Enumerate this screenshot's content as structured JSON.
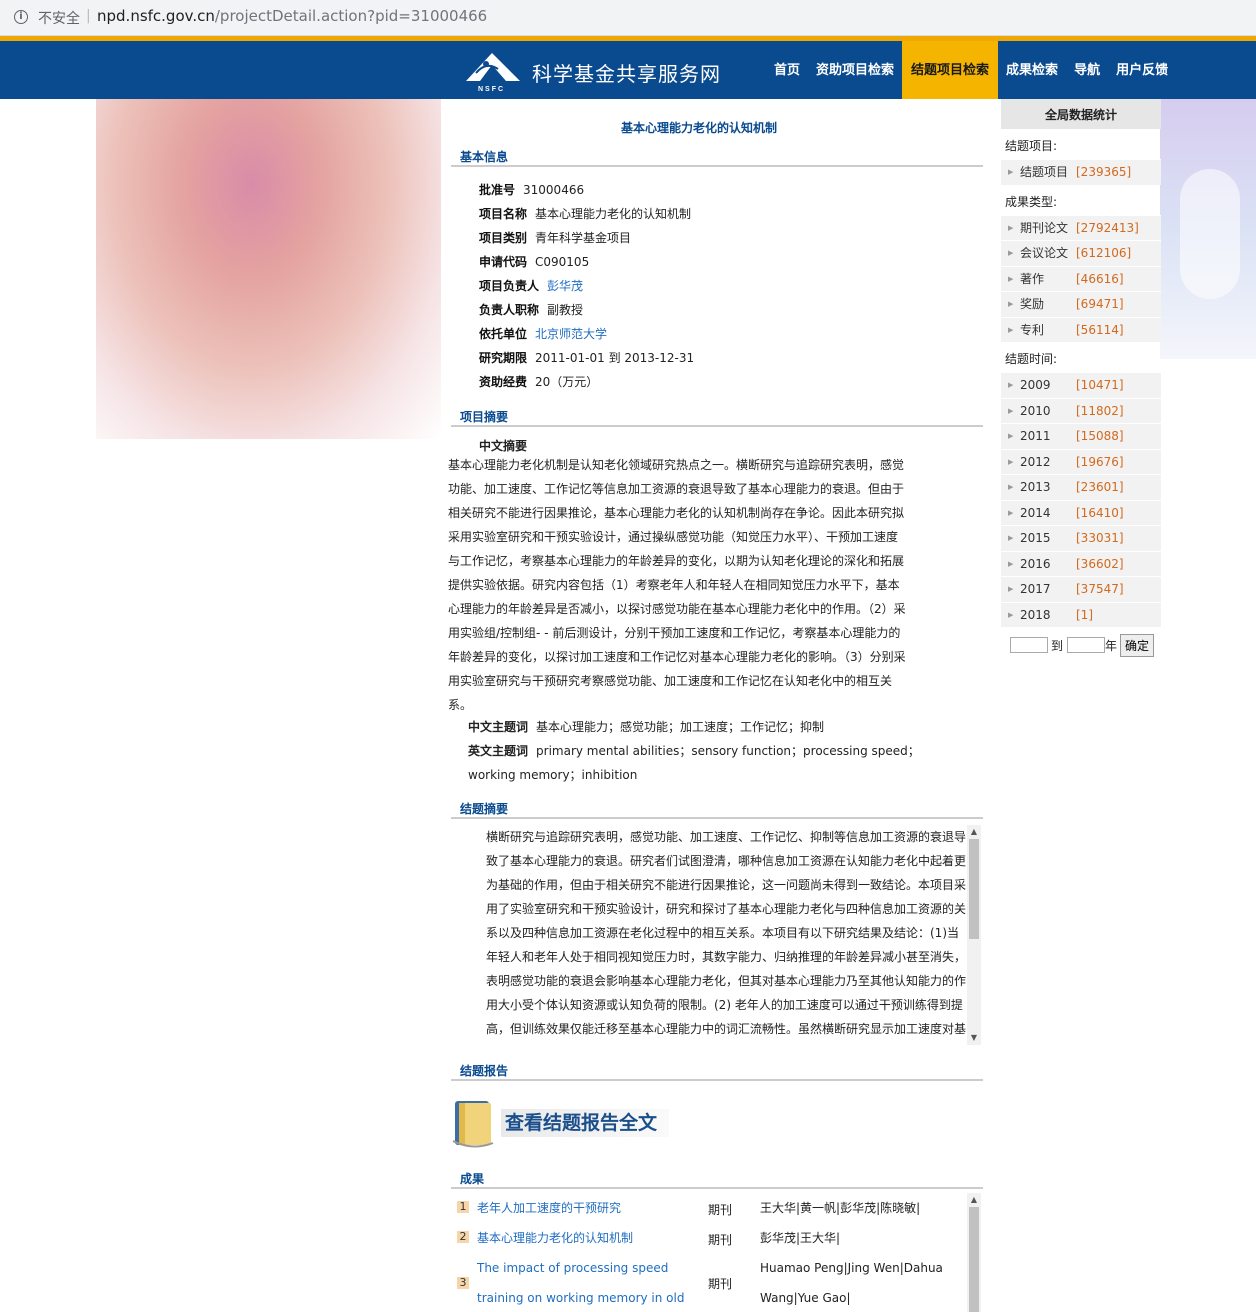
{
  "browser": {
    "security": "不安全",
    "host": "npd.nsfc.gov.cn",
    "path": "/projectDetail.action?pid=31000466"
  },
  "header": {
    "logo_text": "NSFC",
    "site_title": "科学基金共享服务网",
    "nav": [
      {
        "label": "首页"
      },
      {
        "label": "资助项目检索"
      },
      {
        "label": "结题项目检索",
        "active": true
      },
      {
        "label": "成果检索"
      },
      {
        "label": "导航"
      },
      {
        "label": "用户反馈"
      }
    ]
  },
  "project": {
    "title": "基本心理能力老化的认知机制",
    "basic_hd": "基本信息",
    "info": [
      {
        "label": "批准号",
        "value": "31000466"
      },
      {
        "label": "项目名称",
        "value": "基本心理能力老化的认知机制"
      },
      {
        "label": "项目类别",
        "value": "青年科学基金项目"
      },
      {
        "label": "申请代码",
        "value": "C090105"
      },
      {
        "label": "项目负责人",
        "value": "彭华茂"
      },
      {
        "label": "负责人职称",
        "value": "副教授"
      },
      {
        "label": "依托单位",
        "value": "北京师范大学"
      },
      {
        "label": "研究期限",
        "value": "2011-01-01 到 2013-12-31"
      },
      {
        "label": "资助经费",
        "value": "20（万元）"
      }
    ],
    "abstract_hd": "项目摘要",
    "abstract_cn_label": "中文摘要",
    "abstract_cn": "基本心理能力老化机制是认知老化领域研究热点之一。横断研究与追踪研究表明，感觉功能、加工速度、工作记忆等信息加工资源的衰退导致了基本心理能力的衰退。但由于相关研究不能进行因果推论，基本心理能力老化的认知机制尚存在争论。因此本研究拟采用实验室研究和干预实验设计，通过操纵感觉功能（知觉压力水平）、干预加工速度与工作记忆，考察基本心理能力的年龄差异的变化，以期为认知老化理论的深化和拓展提供实验依据。研究内容包括（1）考察老年人和年轻人在相同知觉压力水平下，基本心理能力的年龄差异是否减小，以探讨感觉功能在基本心理能力老化中的作用。（2）采用实验组/控制组- - 前后测设计，分别干预加工速度和工作记忆，考察基本心理能力的年龄差异的变化，以探讨加工速度和工作记忆对基本心理能力老化的影响。（3）分别采用实验室研究与干预研究考察感觉功能、加工速度和工作记忆在认知老化中的相互关系。",
    "kw_cn_label": "中文主题词",
    "kw_cn": "基本心理能力；感觉功能；加工速度；工作记忆；抑制",
    "kw_en_label": "英文主题词",
    "kw_en": "primary mental abilities；sensory function；processing speed；working memory；inhibition",
    "conclusion_hd": "结题摘要",
    "conclusion": "横断研究与追踪研究表明，感觉功能、加工速度、工作记忆、抑制等信息加工资源的衰退导致了基本心理能力的衰退。研究者们试图澄清，哪种信息加工资源在认知能力老化中起着更为基础的作用，但由于相关研究不能进行因果推论，这一问题尚未得到一致结论。本项目采用了实验室研究和干预实验设计，研究和探讨了基本心理能力老化与四种信息加工资源的关系以及四种信息加工资源在老化过程中的相互关系。本项目有以下研究结果及结论：(1)当年轻人和老年人处于相同视知觉压力时，其数字能力、归纳推理的年龄差异减小甚至消失，表明感觉功能的衰退会影响基本心理能力老化，但其对基本心理能力乃至其他认知能力的作用大小受个体认知资源或认知负荷的限制。(2) 老年人的加工速度可以通过干预训练得到提高，但训练效果仅能迁移至基本心理能力中的词汇流畅性。虽然横断研究显示加工速度对基本心理能力的年龄差异具有一定的解释力，但干预训练未能使老年人的基本心理能力全面提升。",
    "report_hd": "结题报告",
    "report_button": "查看结题报告全文",
    "results_hd": "成果",
    "results": [
      {
        "num": "1",
        "title": "老年人加工速度的干预研究",
        "type": "期刊",
        "authors": "王大华|黄一帆|彭华茂|陈晓敏|"
      },
      {
        "num": "2",
        "title": "基本心理能力老化的认知机制",
        "type": "期刊",
        "authors": "彭华茂|王大华|"
      },
      {
        "num": "3",
        "title": "The impact of processing speed training on working memory in old adults",
        "type": "期刊",
        "authors": "Huamao Peng|Jing Wen|Dahua Wang|Yue Gao|"
      }
    ]
  },
  "sidebar": {
    "title": "全局数据统计",
    "groups": [
      {
        "label": "结题项目:",
        "items": [
          {
            "name": "结题项目",
            "count": "[239365]"
          }
        ]
      },
      {
        "label": "成果类型:",
        "items": [
          {
            "name": "期刊论文",
            "count": "[2792413]"
          },
          {
            "name": "会议论文",
            "count": "[612106]"
          },
          {
            "name": "著作",
            "count": "[46616]"
          },
          {
            "name": "奖励",
            "count": "[69471]"
          },
          {
            "name": "专利",
            "count": "[56114]"
          }
        ]
      },
      {
        "label": "结题时间:",
        "items": [
          {
            "name": "2009",
            "count": "[10471]"
          },
          {
            "name": "2010",
            "count": "[11802]"
          },
          {
            "name": "2011",
            "count": "[15088]"
          },
          {
            "name": "2012",
            "count": "[19676]"
          },
          {
            "name": "2013",
            "count": "[23601]"
          },
          {
            "name": "2014",
            "count": "[16410]"
          },
          {
            "name": "2015",
            "count": "[33031]"
          },
          {
            "name": "2016",
            "count": "[36602]"
          },
          {
            "name": "2017",
            "count": "[37547]"
          },
          {
            "name": "2018",
            "count": "[1]"
          }
        ]
      }
    ],
    "to_label": "到",
    "year_label": "年",
    "confirm": "确定"
  }
}
